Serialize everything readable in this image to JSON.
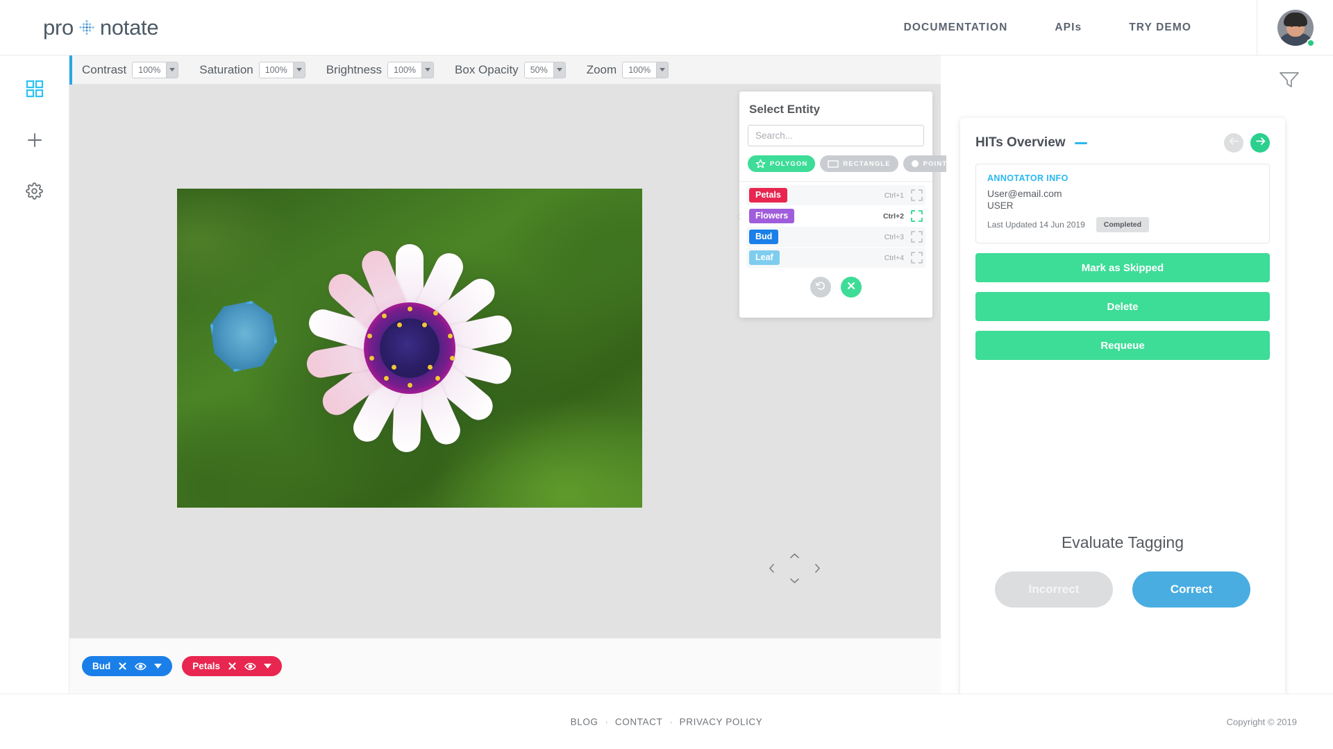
{
  "brand": {
    "name_part1": "pro",
    "name_part2": "notate",
    "diamond_icon": "diamond-dots-icon"
  },
  "topnav": {
    "items": [
      {
        "label": "DOCUMENTATION",
        "name": "nav-documentation"
      },
      {
        "label": "APIs",
        "name": "nav-apis"
      },
      {
        "label": "TRY DEMO",
        "name": "nav-try-demo"
      }
    ],
    "avatar_icon": "user-avatar",
    "status": "online"
  },
  "rail": {
    "items": [
      {
        "icon": "grid-icon",
        "label": "Dashboard",
        "active": true
      },
      {
        "icon": "plus-icon",
        "label": "Add",
        "active": false
      },
      {
        "icon": "gear-icon",
        "label": "Settings",
        "active": false
      }
    ],
    "active_color": "#29c3f5"
  },
  "editor_toolbar": {
    "controls": [
      {
        "label": "Contrast",
        "value": "100%"
      },
      {
        "label": "Saturation",
        "value": "100%"
      },
      {
        "label": "Brightness",
        "value": "100%"
      },
      {
        "label": "Box Opacity",
        "value": "50%"
      },
      {
        "label": "Zoom",
        "value": "100%"
      }
    ],
    "slider_value": 50
  },
  "canvas": {
    "image_alt": "purple and white daisy flower close-up on green leaves",
    "annotations": [
      {
        "entity": "Bud",
        "shape": "polygon",
        "color": "#4fb4e8"
      }
    ],
    "pan_controls": {
      "up": "chevron-up-icon",
      "down": "chevron-down-icon",
      "left": "chevron-left-icon",
      "right": "chevron-right-icon"
    }
  },
  "select_entity": {
    "title": "Select Entity",
    "search_placeholder": "Search...",
    "search_value": "",
    "shapes": [
      {
        "label": "POLYGON",
        "icon": "star-polygon-icon",
        "active": true
      },
      {
        "label": "RECTANGLE",
        "icon": "rectangle-icon",
        "active": false
      },
      {
        "label": "POINT",
        "icon": "point-dot-icon",
        "active": false
      }
    ],
    "entities": [
      {
        "label": "Petals",
        "shortcut": "Ctrl+1",
        "color": "#e8264f",
        "selected": false
      },
      {
        "label": "Flowers",
        "shortcut": "Ctrl+2",
        "color": "#a05ddb",
        "selected": true
      },
      {
        "label": "Bud",
        "shortcut": "Ctrl+3",
        "color": "#1a7fe8",
        "selected": false
      },
      {
        "label": "Leaf",
        "shortcut": "Ctrl+4",
        "color": "#7fcdee",
        "selected": false
      }
    ],
    "actions": [
      {
        "icon": "undo-icon",
        "style": "grey"
      },
      {
        "icon": "close-x-icon",
        "style": "green"
      }
    ]
  },
  "right_panel": {
    "filter_icon": "filter-funnel-icon",
    "hits_title": "HITs Overview",
    "accent_color": "#2bb7f0",
    "nav": {
      "prev_icon": "arrow-left-icon",
      "next_icon": "arrow-right-icon",
      "prev_enabled": false,
      "next_enabled": true
    },
    "annotator": {
      "section_label": "ANNOTATOR INFO",
      "email": "User@email.com",
      "role": "USER",
      "last_updated": "Last Updated 14 Jun 2019",
      "status_badge": "Completed"
    },
    "actions": [
      {
        "label": "Mark as Skipped",
        "name": "mark-as-skipped-button"
      },
      {
        "label": "Delete",
        "name": "delete-button"
      },
      {
        "label": "Requeue",
        "name": "requeue-button"
      }
    ],
    "evaluate": {
      "title": "Evaluate Tagging",
      "incorrect_label": "Incorrect",
      "correct_label": "Correct",
      "incorrect_color": "#dcdddf",
      "correct_color": "#49ade1"
    }
  },
  "tag_bar": {
    "chips": [
      {
        "label": "Bud",
        "color": "#1a7fe8"
      },
      {
        "label": "Petals",
        "color": "#e8264f"
      }
    ],
    "chip_icons": {
      "remove": "close-x-icon",
      "visibility": "eye-icon",
      "more": "chevron-down-icon"
    }
  },
  "footer": {
    "links": [
      {
        "label": "BLOG"
      },
      {
        "label": "CONTACT"
      },
      {
        "label": "PRIVACY POLICY"
      }
    ],
    "separator": "·",
    "copyright": "Copyright © 2019"
  }
}
